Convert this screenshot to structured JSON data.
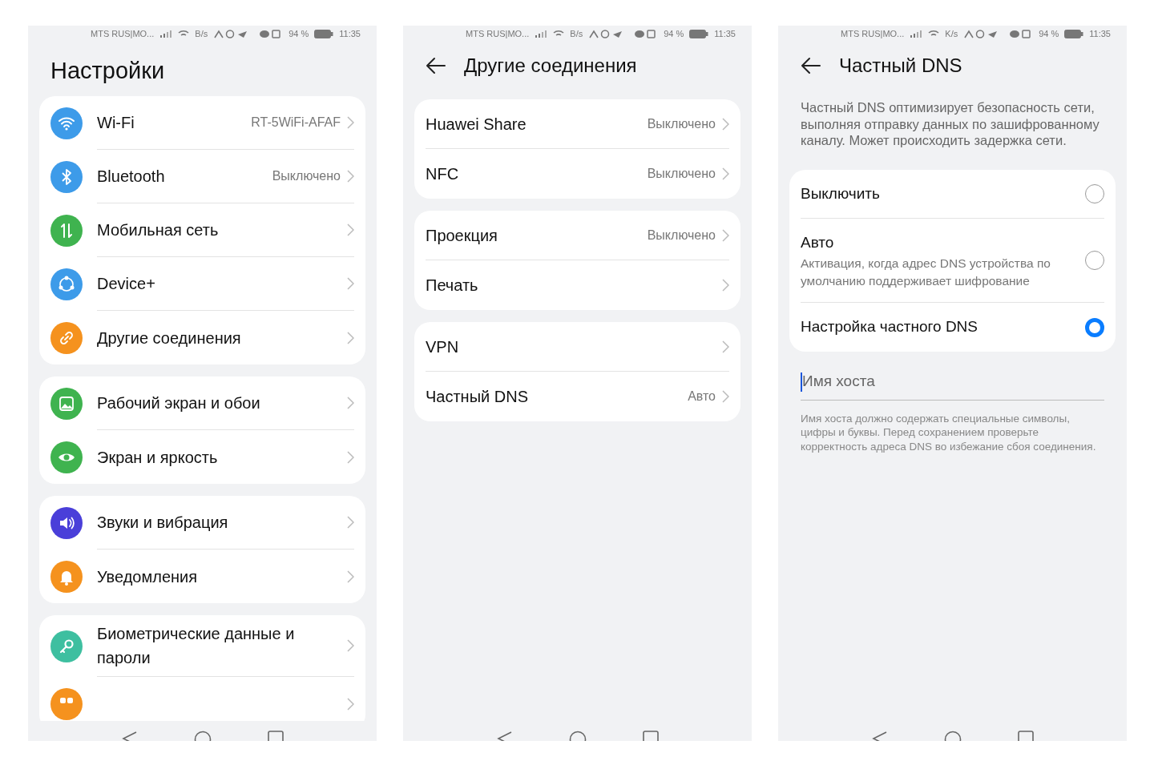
{
  "screens": [
    {
      "kind": "list",
      "status_bar": {
        "carrier": "MTS RUS|MO...",
        "speed": "B/s",
        "battery": "94 %",
        "time": "11:35"
      },
      "title": "Настройки",
      "back": false,
      "groups": [
        {
          "items": [
            {
              "label": "Wi-Fi",
              "value": "RT-5WiFi-AFAF",
              "color": "#3d9be9"
            },
            {
              "label": "Bluetooth",
              "value": "Выключено",
              "color": "#3d9be9"
            },
            {
              "label": "Мобильная сеть",
              "color": "#3fb34f"
            },
            {
              "label": "Device+",
              "color": "#3d9be9"
            },
            {
              "label": "Другие соединения",
              "color": "#f5921e"
            }
          ]
        },
        {
          "items": [
            {
              "label": "Рабочий экран и обои",
              "color": "#3fb34f"
            },
            {
              "label": "Экран и яркость",
              "color": "#3fb34f"
            }
          ]
        },
        {
          "items": [
            {
              "label": "Звуки и вибрация",
              "color": "#4a3fd9"
            },
            {
              "label": "Уведомления",
              "color": "#f5921e"
            }
          ]
        },
        {
          "items": [
            {
              "label": "Биометрические данные и пароли",
              "color": "#3ebfa0"
            },
            {
              "color": "#f5921e"
            }
          ]
        }
      ]
    },
    {
      "kind": "list",
      "status_bar": {
        "carrier": "MTS RUS|MO...",
        "speed": "B/s",
        "battery": "94 %",
        "time": "11:35"
      },
      "title": "Другие соединения",
      "back": true,
      "groups": [
        {
          "items": [
            {
              "label": "Huawei Share",
              "value": "Выключено"
            },
            {
              "label": "NFC",
              "value": "Выключено"
            }
          ]
        },
        {
          "items": [
            {
              "label": "Проекция",
              "value": "Выключено"
            },
            {
              "label": "Печать"
            }
          ]
        },
        {
          "items": [
            {
              "label": "VPN"
            },
            {
              "label": "Частный DNS",
              "value": "Авто"
            }
          ]
        }
      ]
    },
    {
      "kind": "dns",
      "status_bar": {
        "carrier": "MTS RUS|MO...",
        "speed": "K/s",
        "battery": "94 %",
        "time": "11:35"
      },
      "title": "Частный DNS",
      "back": true,
      "description": "Частный DNS оптимизирует безопасность сети, выполняя отправку данных по зашифрованному каналу. Может происходить задержка сети.",
      "options": [
        {
          "label": "Выключить",
          "selected": false
        },
        {
          "label": "Авто",
          "subtitle": "Активация, когда адрес DNS устройства по умолчанию поддерживает шифрование",
          "selected": false
        },
        {
          "label": "Настройка частного DNS",
          "selected": true
        }
      ],
      "hostname_field": {
        "placeholder": "Имя хоста",
        "focused": true
      },
      "hint": "Имя хоста должно содержать специальные символы, цифры и буквы. Перед сохранением проверьте корректность адреса DNS во избежание сбоя соединения."
    }
  ]
}
